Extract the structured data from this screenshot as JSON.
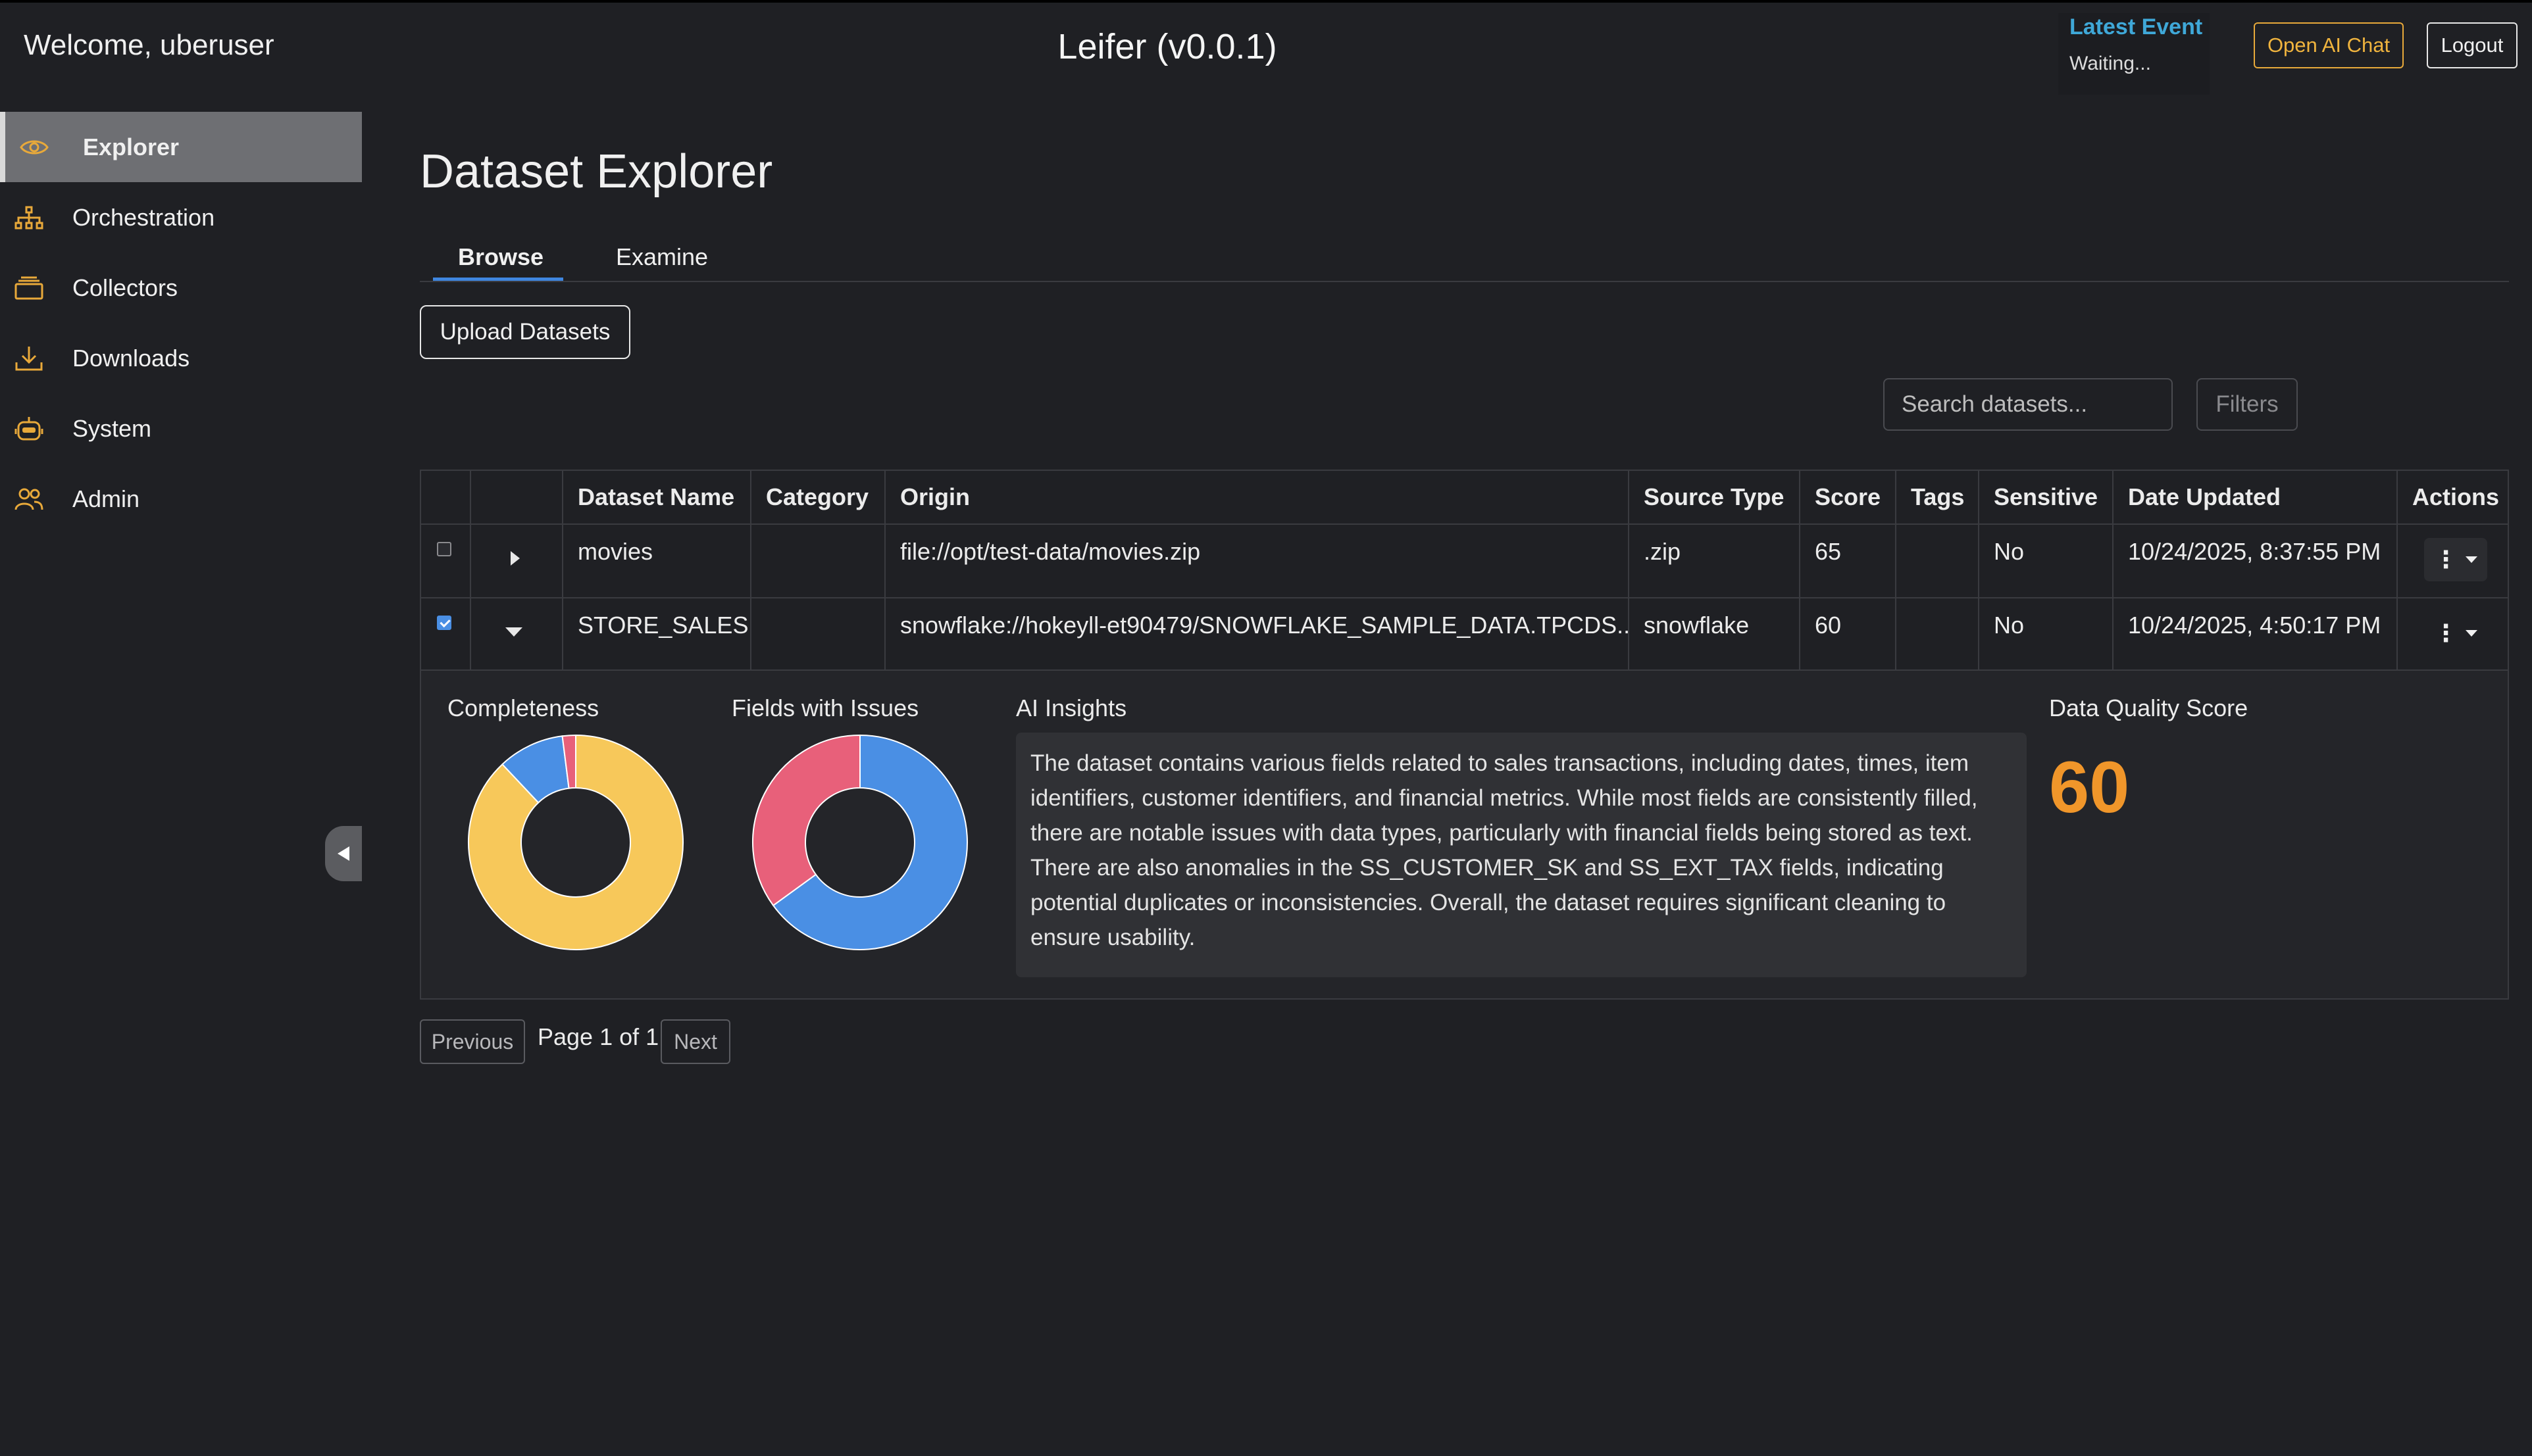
{
  "header": {
    "welcome": "Welcome, uberuser",
    "app_title": "Leifer (v0.0.1)",
    "latest_event_title": "Latest Event",
    "latest_event_status": "Waiting...",
    "ai_chat_label": "Open AI Chat",
    "logout_label": "Logout"
  },
  "sidebar": {
    "items": [
      {
        "label": "Explorer",
        "icon": "eye-icon",
        "active": true
      },
      {
        "label": "Orchestration",
        "icon": "hierarchy-icon"
      },
      {
        "label": "Collectors",
        "icon": "stack-icon"
      },
      {
        "label": "Downloads",
        "icon": "download-icon"
      },
      {
        "label": "System",
        "icon": "robot-icon"
      },
      {
        "label": "Admin",
        "icon": "users-icon"
      }
    ]
  },
  "main": {
    "title": "Dataset Explorer",
    "tabs": [
      {
        "label": "Browse",
        "active": true
      },
      {
        "label": "Examine"
      }
    ],
    "upload_label": "Upload Datasets",
    "search_placeholder": "Search datasets...",
    "filters_label": "Filters"
  },
  "table": {
    "columns": [
      "Dataset Name",
      "Category",
      "Origin",
      "Source Type",
      "Score",
      "Tags",
      "Sensitive",
      "Date Updated",
      "Actions"
    ],
    "rows": [
      {
        "checked": false,
        "expanded": false,
        "name": "movies",
        "category": "",
        "origin": "file://opt/test-data/movies.zip",
        "source_type": ".zip",
        "score": "65",
        "tags": "",
        "sensitive": "No",
        "date_updated": "10/24/2025, 8:37:55 PM"
      },
      {
        "checked": true,
        "expanded": true,
        "name": "STORE_SALES",
        "category": "",
        "origin": "snowflake://hokeyll-et90479/SNOWFLAKE_SAMPLE_DATA.TPCDS...",
        "source_type": "snowflake",
        "score": "60",
        "tags": "",
        "sensitive": "No",
        "date_updated": "10/24/2025, 4:50:17 PM"
      }
    ]
  },
  "details": {
    "completeness_label": "Completeness",
    "fields_issues_label": "Fields with Issues",
    "ai_insights_label": "AI Insights",
    "quality_label": "Data Quality Score",
    "quality_score": "60",
    "ai_insights_text": "The dataset contains various fields related to sales transactions, including dates, times, item identifiers, customer identifiers, and financial metrics. While most fields are consistently filled, there are notable issues with data types, particularly with financial fields being stored as text. There are also anomalies in the SS_CUSTOMER_SK and SS_EXT_TAX fields, indicating potential duplicates or inconsistencies. Overall, the dataset requires significant cleaning to ensure usability."
  },
  "chart_data": [
    {
      "type": "pie",
      "variant": "donut",
      "slices": [
        {
          "value": 0.88,
          "color": "#f7c85a"
        },
        {
          "value": 0.1,
          "color": "#4a8fe4"
        },
        {
          "value": 0.02,
          "color": "#e8607a"
        }
      ]
    },
    {
      "type": "pie",
      "variant": "donut",
      "slices": [
        {
          "value": 0.65,
          "color": "#4a8fe4"
        },
        {
          "value": 0.35,
          "color": "#e8607a"
        }
      ]
    }
  ],
  "pagination": {
    "previous_label": "Previous",
    "page_text": "Page 1 of 1",
    "next_label": "Next"
  },
  "colors": {
    "accent_blue": "#3fa8d8",
    "accent_orange": "#f0962a",
    "ai_chat_border": "#e8a93a"
  }
}
